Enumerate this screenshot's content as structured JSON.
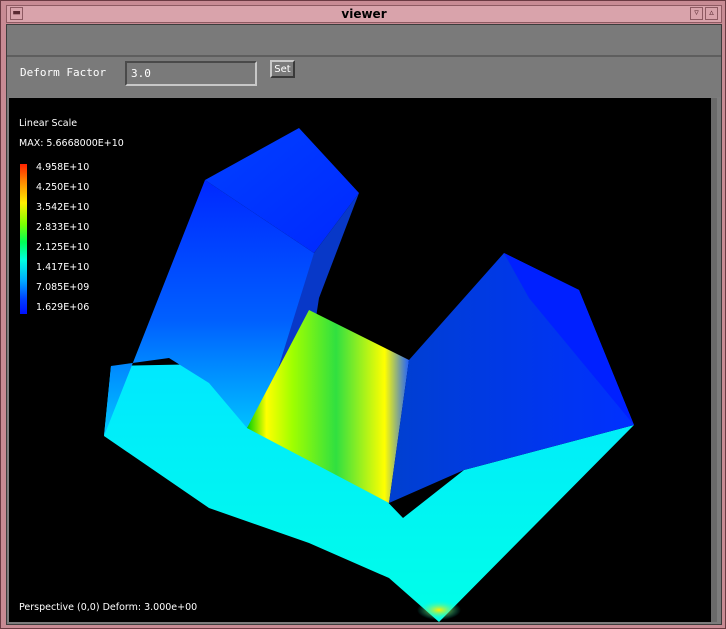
{
  "window": {
    "title": "viewer"
  },
  "controls": {
    "deform_label": "Deform Factor",
    "deform_value": "3.0",
    "set_label": "Set"
  },
  "legend": {
    "scale_label": "Linear Scale",
    "max_label": "MAX:  5.6668000E+10",
    "ticks": [
      "4.958E+10",
      "4.250E+10",
      "3.542E+10",
      "2.833E+10",
      "2.125E+10",
      "1.417E+10",
      "7.085E+09",
      "1.629E+06"
    ]
  },
  "status": {
    "text": "Perspective (0,0) Deform:  3.000e+00"
  },
  "colors": {
    "frame": "#c88b94",
    "panel": "#7a7a7a",
    "viewport": "#000000",
    "low": "#0010ff",
    "mid": "#00ffe0",
    "high": "#ffee00"
  }
}
